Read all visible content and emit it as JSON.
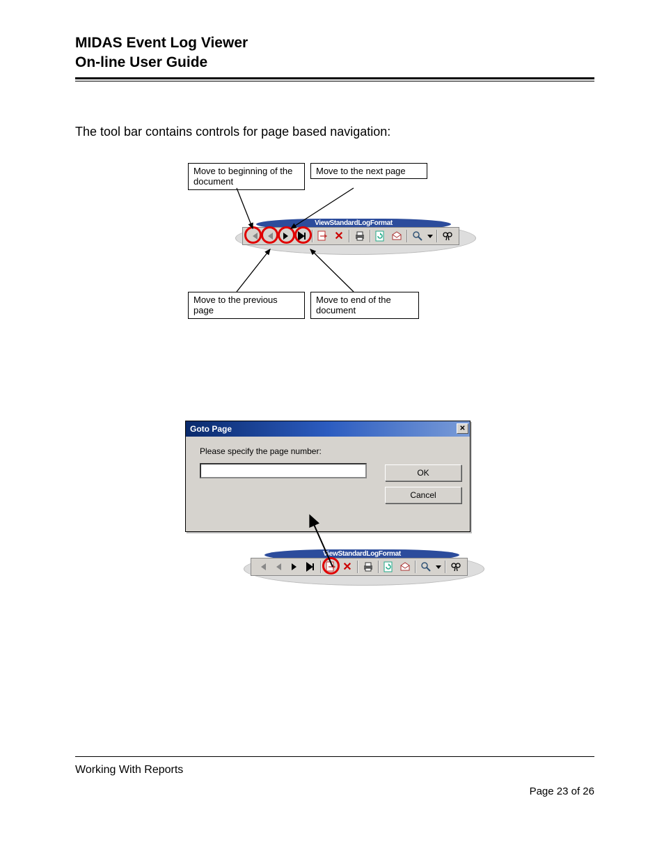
{
  "header": {
    "line1": "MIDAS Event Log Viewer",
    "line2": "On-line User Guide"
  },
  "intro": "The tool bar contains controls for page based navigation:",
  "toolbar_title_fragment": "ViewStandardLogFormat",
  "callouts": {
    "top_left": "Move to beginning of the document",
    "top_right": "Move to the next page",
    "bot_left": "Move to the previous page",
    "bot_right": "Move to end of the document"
  },
  "toolbar_icons": {
    "first": "first-page",
    "prev": "previous-page",
    "next": "next-page",
    "last": "last-page",
    "goto": "goto-page",
    "stop": "stop",
    "print": "print",
    "refresh": "refresh",
    "export": "export",
    "zoom": "zoom",
    "dropdown": "dropdown",
    "find": "find"
  },
  "dialog": {
    "title": "Goto Page",
    "prompt": "Please specify the page number:",
    "input_value": "",
    "ok": "OK",
    "cancel": "Cancel"
  },
  "footer": {
    "section": "Working With Reports",
    "page": "Page 23 of 26"
  }
}
